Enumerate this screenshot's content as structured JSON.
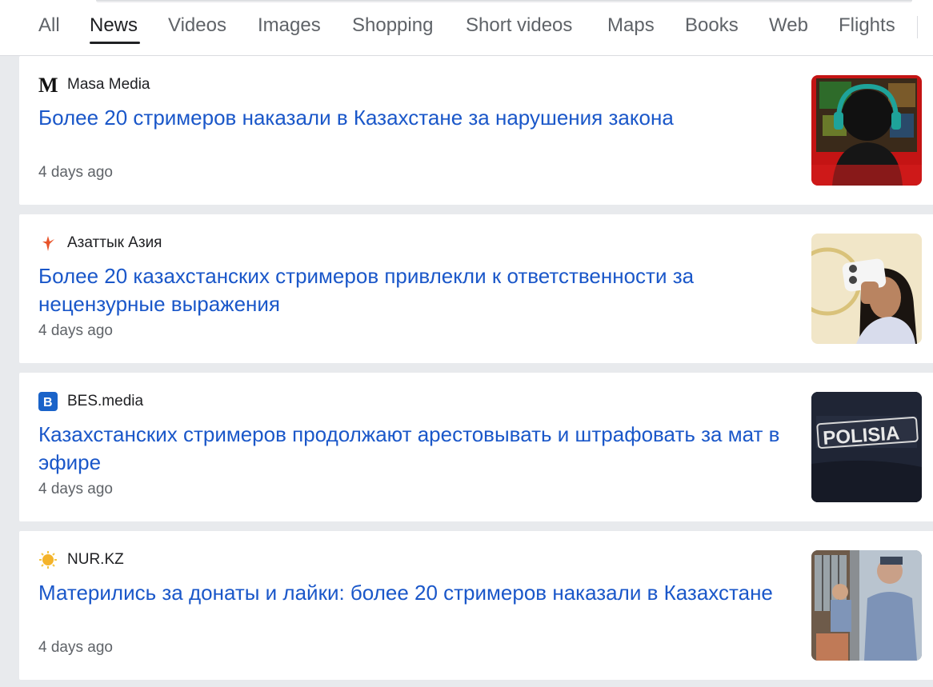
{
  "tabs": [
    {
      "label": "All"
    },
    {
      "label": "News"
    },
    {
      "label": "Videos"
    },
    {
      "label": "Images"
    },
    {
      "label": "Shopping"
    },
    {
      "label": "Short videos"
    },
    {
      "label": "Maps"
    },
    {
      "label": "Books"
    },
    {
      "label": "Web"
    },
    {
      "label": "Flights"
    }
  ],
  "active_tab": "News",
  "colors": {
    "headline": "#1a57c9",
    "meta": "#5f6368",
    "background": "#e8eaed"
  },
  "results": [
    {
      "source": "Masa Media",
      "source_icon": "masa-media-logo-icon",
      "headline": "Более 20 стримеров наказали в Казахстане за нарушения закона",
      "time": "4 days ago",
      "thumbnail": "gamer-with-headphones-thumbnail"
    },
    {
      "source": "Азаттык Азия",
      "source_icon": "azattyk-logo-icon",
      "headline": "Более 20 казахстанских стримеров привлекли к ответственности за нецензурные выражения",
      "time": "4 days ago",
      "thumbnail": "girl-taking-selfie-thumbnail"
    },
    {
      "source": "BES.media",
      "source_icon": "bes-media-logo-icon",
      "headline": "Казахстанских стримеров продолжают арестовывать и штрафовать за мат в эфире",
      "time": "4 days ago",
      "thumbnail": "police-uniform-thumbnail"
    },
    {
      "source": "NUR.KZ",
      "source_icon": "nur-kz-logo-icon",
      "headline": "Матерились за донаты и лайки: более 20 стримеров наказали в Казахстане",
      "time": "4 days ago",
      "thumbnail": "police-officers-thumbnail"
    }
  ]
}
